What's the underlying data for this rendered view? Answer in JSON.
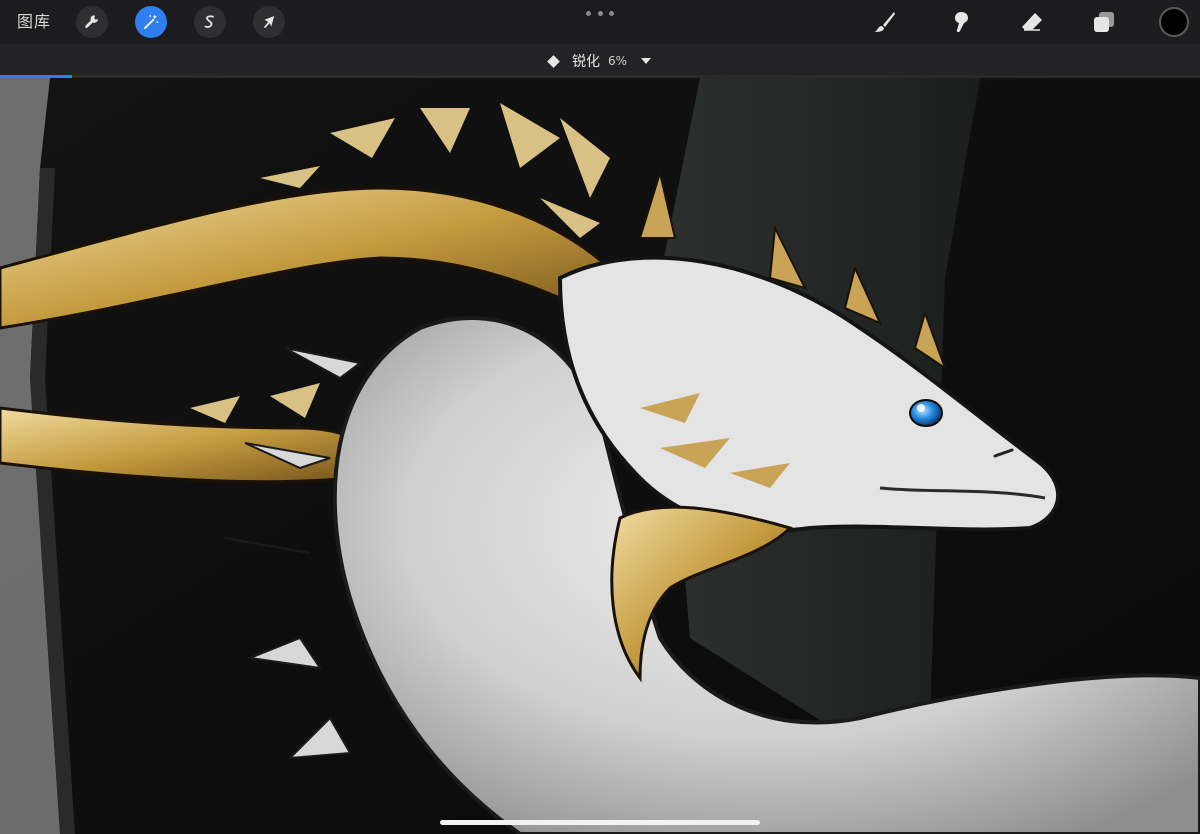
{
  "toolbar": {
    "gallery_label": "图库",
    "left_tools": [
      {
        "icon": "wrench-icon",
        "name": "actions"
      },
      {
        "icon": "magic-wand-icon",
        "name": "adjustments",
        "active": true
      },
      {
        "icon": "selection-s-icon",
        "name": "selection"
      },
      {
        "icon": "arrow-cursor-icon",
        "name": "transform"
      }
    ],
    "right_tools": [
      {
        "icon": "brush-icon",
        "name": "paint"
      },
      {
        "icon": "smudge-icon",
        "name": "smudge"
      },
      {
        "icon": "eraser-icon",
        "name": "erase"
      },
      {
        "icon": "layers-icon",
        "name": "layers"
      }
    ],
    "current_color": "#000000",
    "accent_color": "#2f7ff0"
  },
  "adjustment": {
    "label": "锐化",
    "value": "6%",
    "progress_percent": 6
  }
}
